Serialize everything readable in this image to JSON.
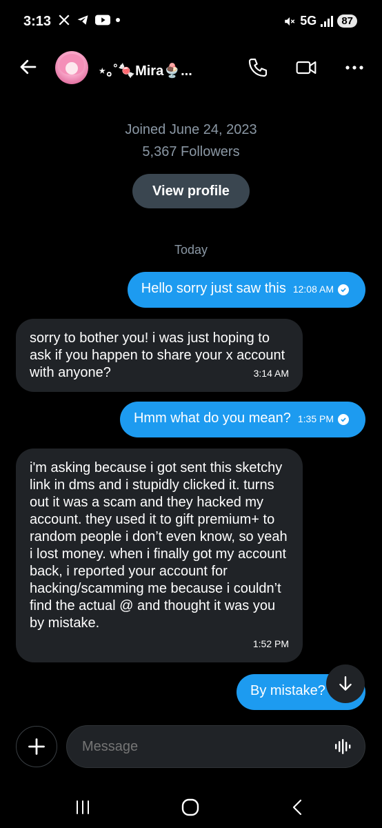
{
  "status_bar": {
    "time": "3:13",
    "network": "5G",
    "battery": "87"
  },
  "header": {
    "contact_name": "⋆｡˚🍬Mira🍨...",
    "back_icon": "arrow-left-icon",
    "call_icon": "phone-icon",
    "video_icon": "video-icon",
    "more_icon": "more-icon"
  },
  "profile": {
    "joined": "Joined June 24, 2023",
    "followers": "5,367 Followers",
    "view_profile_label": "View profile"
  },
  "date_divider": "Today",
  "messages": [
    {
      "direction": "out",
      "text": "Hello sorry just saw this",
      "time": "12:08 AM",
      "read": true
    },
    {
      "direction": "in",
      "text": "sorry to bother you! i was just hoping to ask if you happen to share your x account with anyone?",
      "time": "3:14 AM"
    },
    {
      "direction": "out",
      "text": "Hmm what do you mean?",
      "time": "1:35 PM",
      "read": true
    },
    {
      "direction": "in",
      "text": "i'm asking because i got sent this sketchy link in dms and i stupidly clicked it. turns out it was a scam and they hacked my account. they used it to gift premium+ to random people i don’t even know, so yeah i lost money. when i finally got my account back, i reported your account for hacking/scamming me because i couldn’t find the actual @ and thought it was you by mistake.",
      "time": "1:52 PM"
    },
    {
      "direction": "out",
      "text": "By mistake?",
      "time": ""
    }
  ],
  "composer": {
    "placeholder": "Message"
  },
  "colors": {
    "accent": "#1d9bf0",
    "incoming_bubble": "#202327",
    "background": "#000000",
    "muted_text": "#8b98a5"
  }
}
